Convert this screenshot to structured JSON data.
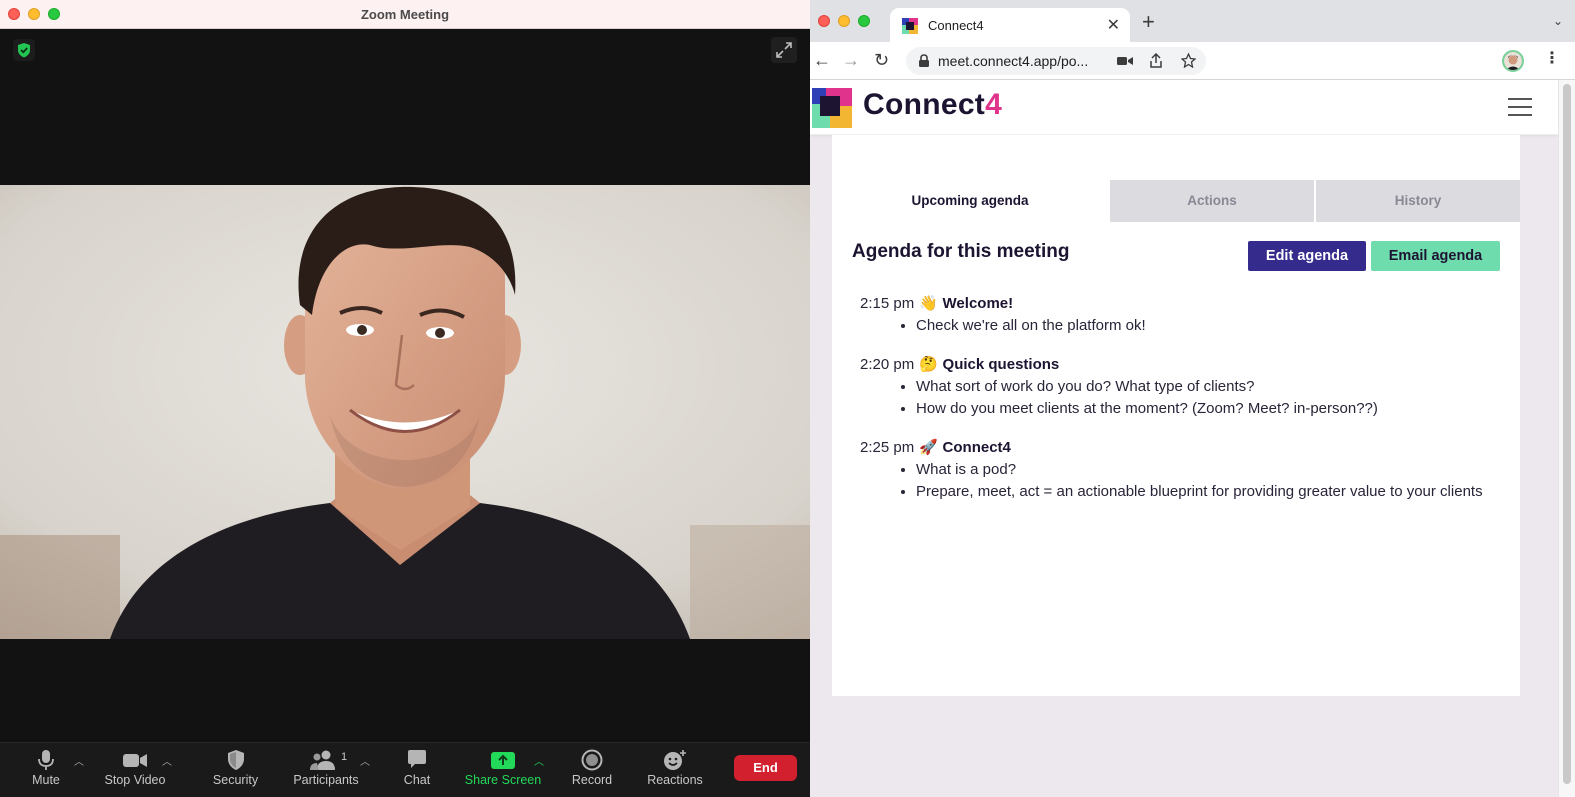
{
  "zoom": {
    "window_title": "Zoom Meeting",
    "toolbar": {
      "mute": "Mute",
      "stop_video": "Stop Video",
      "security": "Security",
      "participants": "Participants",
      "participant_count": "1",
      "chat": "Chat",
      "share_screen": "Share Screen",
      "record": "Record",
      "reactions": "Reactions",
      "end": "End"
    }
  },
  "browser": {
    "tab_title": "Connect4",
    "url": "meet.connect4.app/po...",
    "new_tab_symbol": "+",
    "close_tab_symbol": "✕"
  },
  "site": {
    "logo_text": "Connect",
    "logo_digit": "4",
    "tabs": [
      "Upcoming agenda",
      "Actions",
      "History"
    ],
    "heading": "Agenda for this meeting",
    "edit_button": "Edit agenda",
    "email_button": "Email agenda",
    "agenda": [
      {
        "time": "2:15 pm",
        "emoji": "👋",
        "title": "Welcome!",
        "bullets": [
          "Check we're all on the platform ok!"
        ]
      },
      {
        "time": "2:20 pm",
        "emoji": "🤔",
        "title": "Quick questions",
        "bullets": [
          "What sort of work do you do? What type of clients?",
          "How do you meet clients at the moment? (Zoom? Meet? in-person??)"
        ]
      },
      {
        "time": "2:25 pm",
        "emoji": "🚀",
        "title": "Connect4",
        "bullets": [
          "What is a pod?",
          "Prepare, meet, act = an actionable blueprint for providing greater value to your clients"
        ]
      }
    ]
  },
  "colors": {
    "brand_navy": "#1d1432",
    "brand_pink": "#e0338b",
    "edit_button": "#352b8c",
    "email_button": "#6fdcad",
    "zoom_end": "#d2202f",
    "zoom_share_green": "#23d959"
  }
}
